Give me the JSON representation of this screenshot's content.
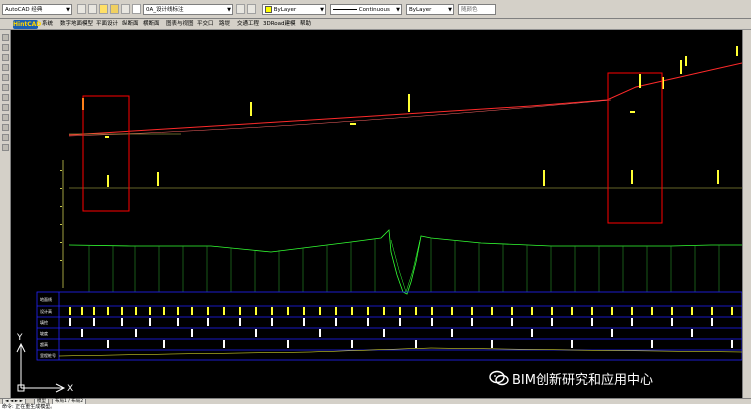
{
  "toolbar": {
    "workspace": "AutoCAD 经典",
    "layer_name": "0A_设计线标注",
    "color": "ByLayer",
    "linetype": "Continuous",
    "lineweight": "ByLayer",
    "plotstyle": "随颜色"
  },
  "menubar": {
    "logo_text": "HintCAD",
    "items": [
      "系统",
      "数字地面模型",
      "平面设计",
      "纵断面",
      "横断面",
      "图表与视图",
      "平交口",
      "路堤",
      "交通工程",
      "3DRoad建模",
      "帮助"
    ]
  },
  "canvas": {
    "ucs": {
      "y_label": "Y",
      "x_label": "X"
    },
    "band_titles": [
      "地面线",
      "设计高",
      "填挖",
      "坡度",
      "超高",
      "里程桩号"
    ],
    "colors": {
      "design_line": "#ff2a2a",
      "profile_green": "#33ff33",
      "label_yellow": "#ffff33",
      "band_blue": "#2222ff",
      "highlight_box": "#ff0000"
    }
  },
  "watermark": {
    "text": "BIM创新研究和应用中心",
    "icon": "wechat-icon"
  },
  "tabs": {
    "nav": "◄ ◄ ► ►",
    "items": [
      "模型",
      "布局1 / 布局2"
    ]
  },
  "command_line": {
    "text": "命令: 正在重生成模型。"
  }
}
